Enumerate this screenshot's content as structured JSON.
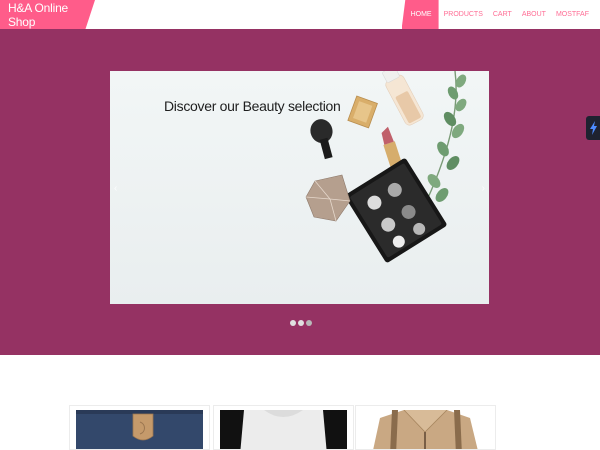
{
  "brand": {
    "name": "H&A Online Shop"
  },
  "nav": {
    "items": [
      {
        "label": "HOME",
        "active": true
      },
      {
        "label": "PRODUCTS",
        "active": false
      },
      {
        "label": "CART",
        "active": false
      },
      {
        "label": "ABOUT",
        "active": false
      },
      {
        "label": "MOSTFAF",
        "active": false
      }
    ]
  },
  "hero": {
    "slide_caption": "Discover our Beauty selection",
    "prev_icon": "chevron-left-icon",
    "next_icon": "chevron-right-icon",
    "indicator_count": 3,
    "active_indicator": 1
  },
  "products": [
    {
      "image": "navy-tote-bag"
    },
    {
      "image": "grey-sweater"
    },
    {
      "image": "tan-jacket"
    }
  ],
  "colors": {
    "accent_pink": "#ff5c8a",
    "hero_background": "#953263"
  }
}
